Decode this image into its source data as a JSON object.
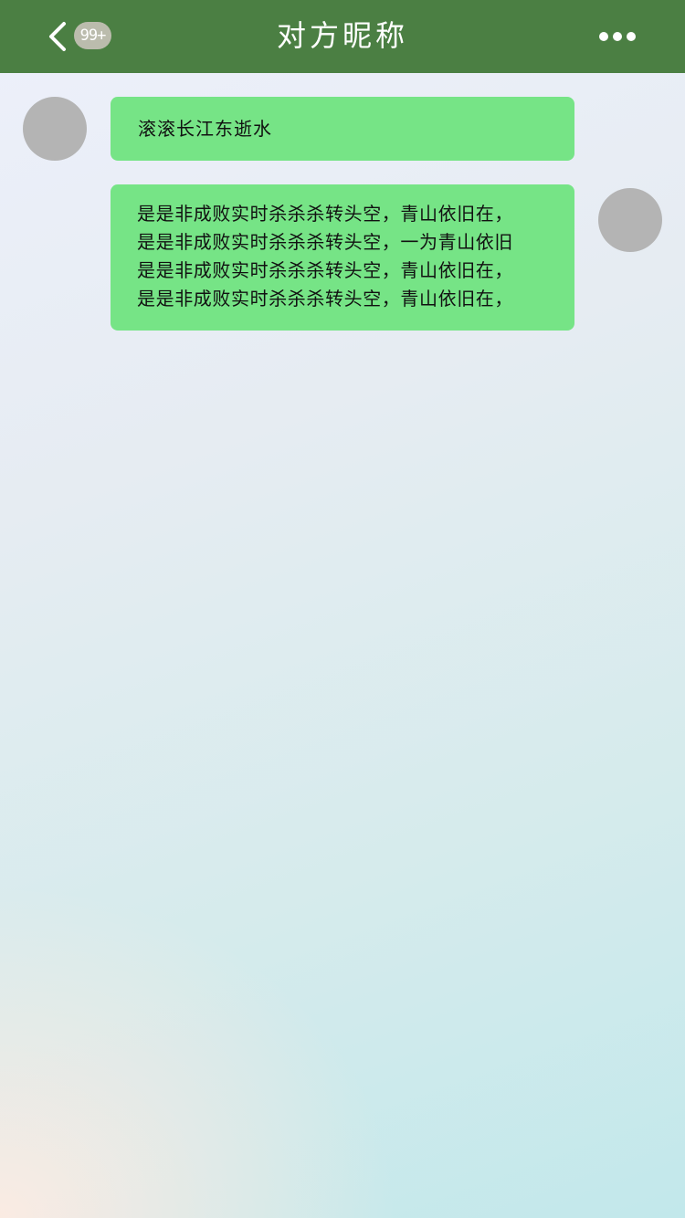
{
  "header": {
    "title": "对方昵称",
    "unread_badge": "99+",
    "back_icon": "chevron-left-icon",
    "more_icon": "more-horizontal-icon",
    "bar_color": "#4b7f43"
  },
  "messages": [
    {
      "side": "left",
      "text": "滚滚长江东逝水"
    },
    {
      "side": "right",
      "lines": [
        "是是非成败实时杀杀杀转头空，青山依旧在，",
        "是是非成败实时杀杀杀转头空，一为青山依旧",
        "是是非成败实时杀杀杀转头空，青山依旧在，",
        "是是非成败实时杀杀杀转头空，青山依旧在，"
      ]
    }
  ],
  "colors": {
    "bubble": "#76e486",
    "avatar_placeholder": "#b4b4b4",
    "badge": "#bbbcad"
  }
}
